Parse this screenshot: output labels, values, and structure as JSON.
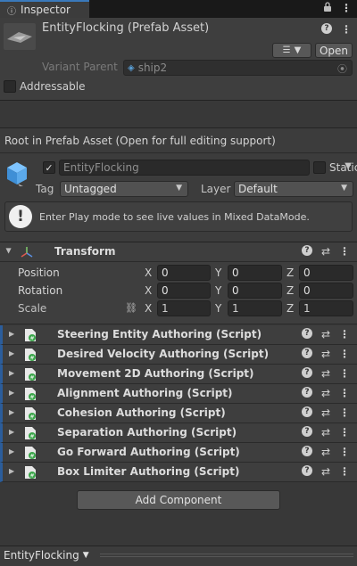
{
  "tab": {
    "title": "Inspector"
  },
  "header": {
    "asset_title": "EntityFlocking (Prefab Asset)",
    "open_label": "Open",
    "variant_parent_label": "Variant Parent",
    "variant_parent_value": "ship2",
    "addressable_label": "Addressable"
  },
  "root_message": "Root in Prefab Asset (Open for full editing support)",
  "gameobject": {
    "name": "EntityFlocking",
    "static_label": "Static",
    "tag_label": "Tag",
    "tag_value": "Untagged",
    "layer_label": "Layer",
    "layer_value": "Default",
    "info_text": "Enter Play mode to see live values in Mixed DataMode."
  },
  "transform": {
    "title": "Transform",
    "rows": [
      {
        "label": "Position",
        "x": "0",
        "y": "0",
        "z": "0"
      },
      {
        "label": "Rotation",
        "x": "0",
        "y": "0",
        "z": "0"
      },
      {
        "label": "Scale",
        "x": "1",
        "y": "1",
        "z": "1"
      }
    ],
    "axes": {
      "x": "X",
      "y": "Y",
      "z": "Z"
    }
  },
  "components": [
    "Steering Entity Authoring (Script)",
    "Desired Velocity Authoring (Script)",
    "Movement 2D Authoring (Script)",
    "Alignment Authoring (Script)",
    "Cohesion Authoring (Script)",
    "Separation Authoring (Script)",
    "Go Forward Authoring (Script)",
    "Box Limiter Authoring (Script)"
  ],
  "add_component_label": "Add Component",
  "footer": {
    "selection_label": "EntityFlocking"
  },
  "colors": {
    "accent": "#3a79bb",
    "script_bar": "#2b5d9b",
    "background": "#383838"
  }
}
